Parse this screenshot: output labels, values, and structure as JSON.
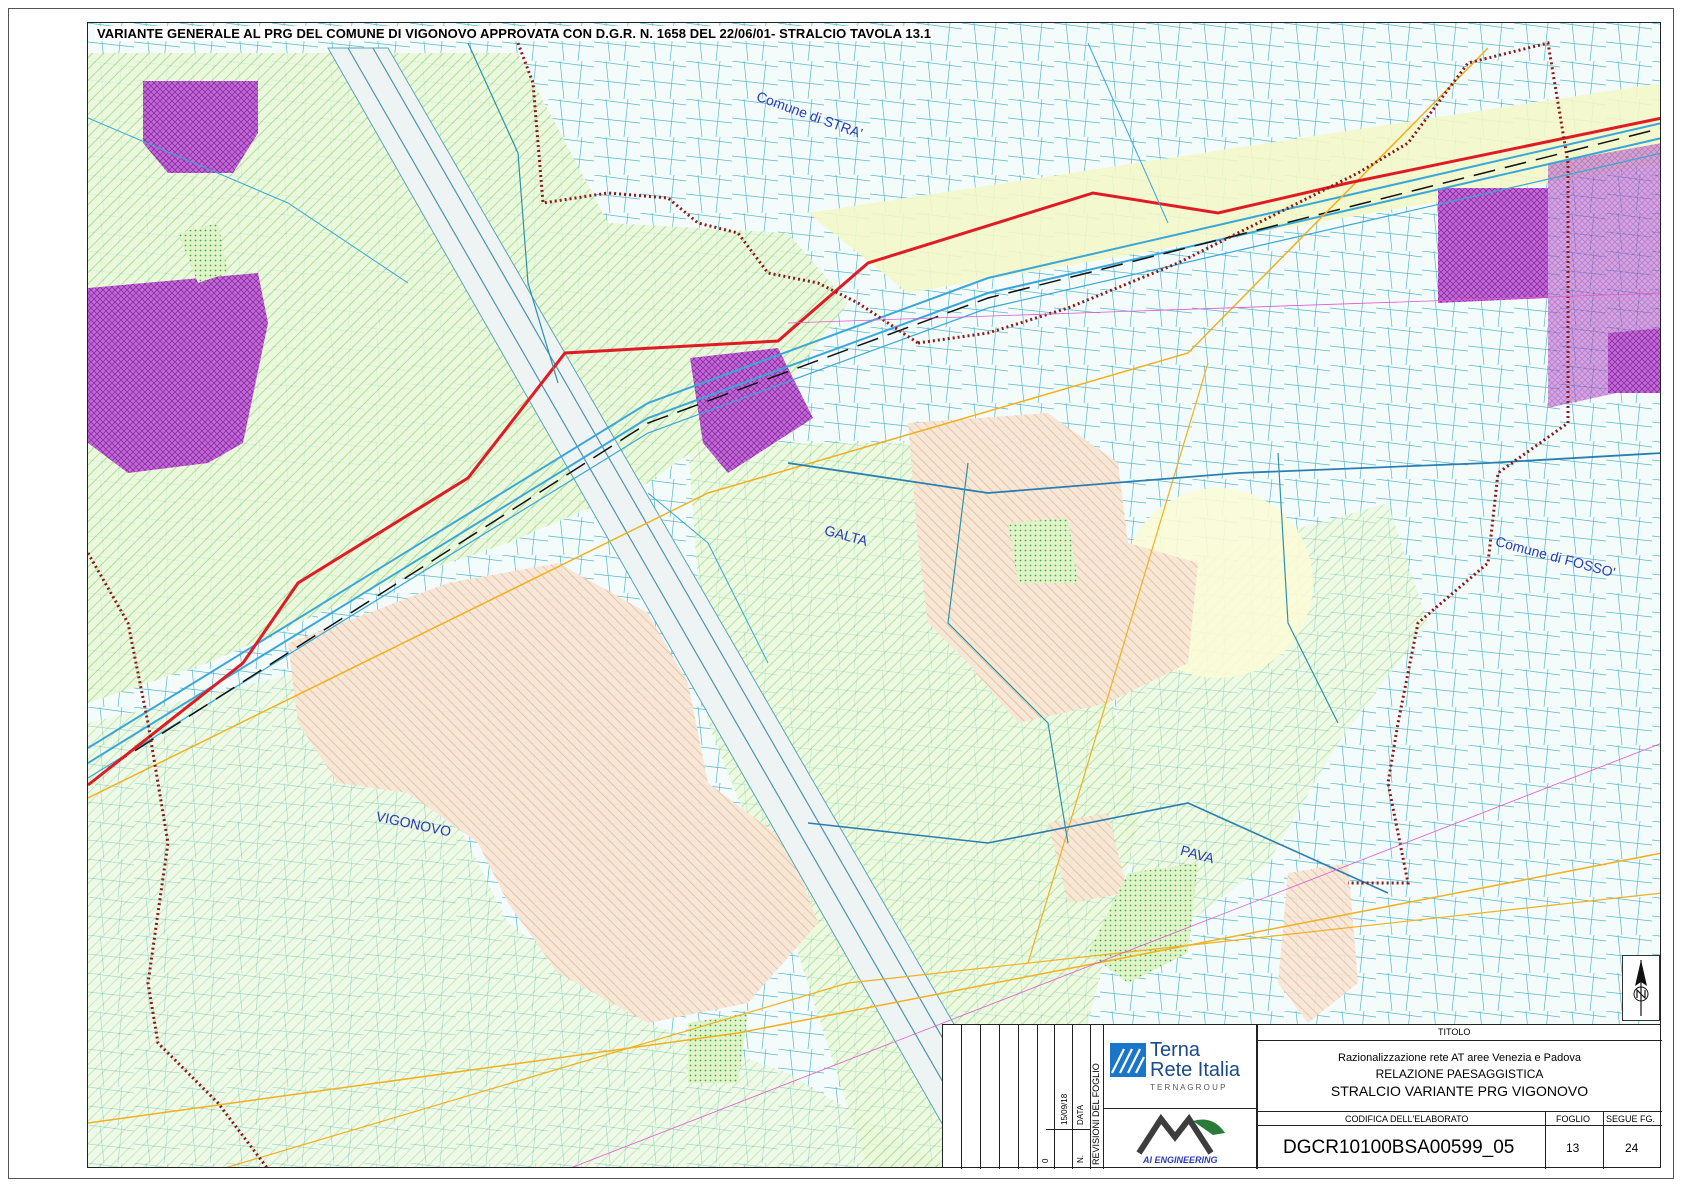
{
  "map": {
    "title": "VARIANTE GENERALE AL PRG DEL COMUNE DI VIGONOVO APPROVATA CON D.G.R. N. 1658 DEL 22/06/01- STRALCIO TAVOLA 13.1",
    "places": {
      "stra": "Comune di STRA'",
      "galta": "GALTA",
      "fosso": "Comune di FOSSO'",
      "vigonovo": "VIGONOVO",
      "pava": "PAVA"
    },
    "colors": {
      "background": "#f4fbfb",
      "agricultural_hatch": "#9fdd86",
      "residential_hatch": "#e8b48a",
      "industrial_zone": "#b34fc8",
      "power_line": "#e01b24",
      "secondary_line": "#f2b01e",
      "municipal_border": "#8b1a1a",
      "canal": "#3aa7d8",
      "road_network": "#2b93a8"
    }
  },
  "title_block": {
    "revisions": {
      "number": "0",
      "date": "15/09/18",
      "col_n": "N.",
      "col_data": "DATA",
      "label": "REVISIONI DEL FOGLIO"
    },
    "logo_terna": {
      "line1": "Terna",
      "line2": "Rete Italia",
      "group": "T E R N A   G R O U P"
    },
    "logo_ai": {
      "text": "AI ENGINEERING"
    },
    "titolo_label": "TITOLO",
    "title_line1": "Razionalizzazione rete AT aree Venezia e Padova",
    "title_line2": "RELAZIONE PAESAGGISTICA",
    "title_line3": "STRALCIO VARIANTE PRG VIGONOVO",
    "codifica_label": "CODIFICA DELL'ELABORATO",
    "codifica_value": "DGCR10100BSA00599_05",
    "foglio_label": "FOGLIO",
    "foglio_value": "13",
    "segue_label": "SEGUE FG.",
    "segue_value": "24"
  }
}
